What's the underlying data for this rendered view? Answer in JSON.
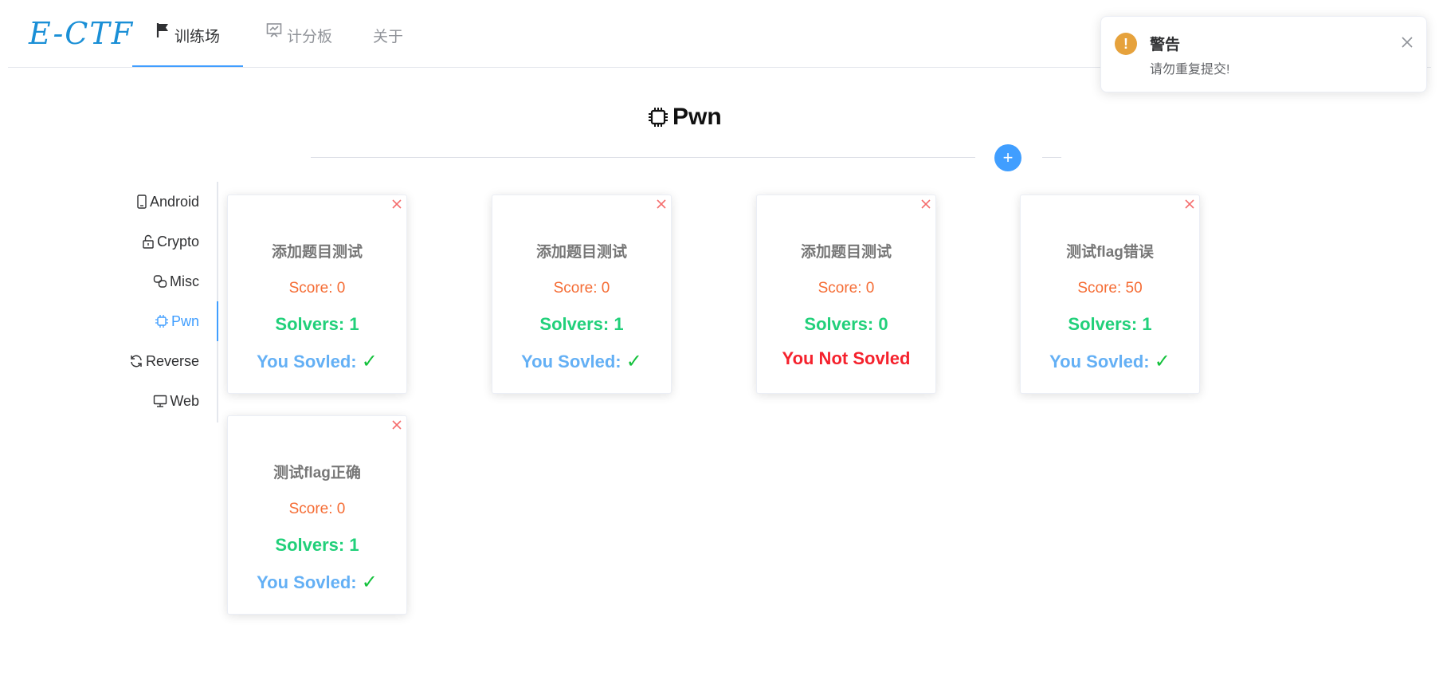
{
  "header": {
    "logo": "E-CTF",
    "nav": [
      {
        "label": "训练场",
        "icon": "flag-icon",
        "active": true
      },
      {
        "label": "计分板",
        "icon": "scoreboard-icon",
        "active": false
      },
      {
        "label": "关于",
        "icon": "",
        "active": false
      }
    ]
  },
  "page": {
    "title": "Pwn",
    "title_icon": "cpu-icon",
    "add_label": "+"
  },
  "sidebar": {
    "tabs": [
      {
        "label": "Android",
        "icon": "mobile-icon",
        "active": false
      },
      {
        "label": "Crypto",
        "icon": "lock-icon",
        "active": false
      },
      {
        "label": "Misc",
        "icon": "link-icon",
        "active": false
      },
      {
        "label": "Pwn",
        "icon": "cpu-icon",
        "active": true
      },
      {
        "label": "Reverse",
        "icon": "refresh-icon",
        "active": false
      },
      {
        "label": "Web",
        "icon": "monitor-icon",
        "active": false
      }
    ]
  },
  "cards": [
    {
      "title": "添加题目测试",
      "score": "Score: 0",
      "solvers": "Solvers: 1",
      "status": "You Sovled: ",
      "solved": true,
      "check": "✓"
    },
    {
      "title": "添加题目测试",
      "score": "Score: 0",
      "solvers": "Solvers: 1",
      "status": "You Sovled: ",
      "solved": true,
      "check": "✓"
    },
    {
      "title": "添加题目测试",
      "score": "Score: 0",
      "solvers": "Solvers: 0",
      "status": "You Not Sovled",
      "solved": false,
      "check": ""
    },
    {
      "title": "测试flag错误",
      "score": "Score: 50",
      "solvers": "Solvers: 1",
      "status": "You Sovled: ",
      "solved": true,
      "check": "✓"
    },
    {
      "title": "测试flag正确",
      "score": "Score: 0",
      "solvers": "Solvers: 1",
      "status": "You Sovled: ",
      "solved": true,
      "check": "✓"
    }
  ],
  "notification": {
    "type": "warning",
    "icon": "!",
    "title": "警告",
    "message": "请勿重复提交!"
  },
  "colors": {
    "accent": "#409eff",
    "score": "#f56c34",
    "solvers": "#21d07a",
    "solved": "#64b0f5",
    "not_solved": "#f5222d",
    "check": "#14c13c",
    "warning": "#e6a23c"
  }
}
